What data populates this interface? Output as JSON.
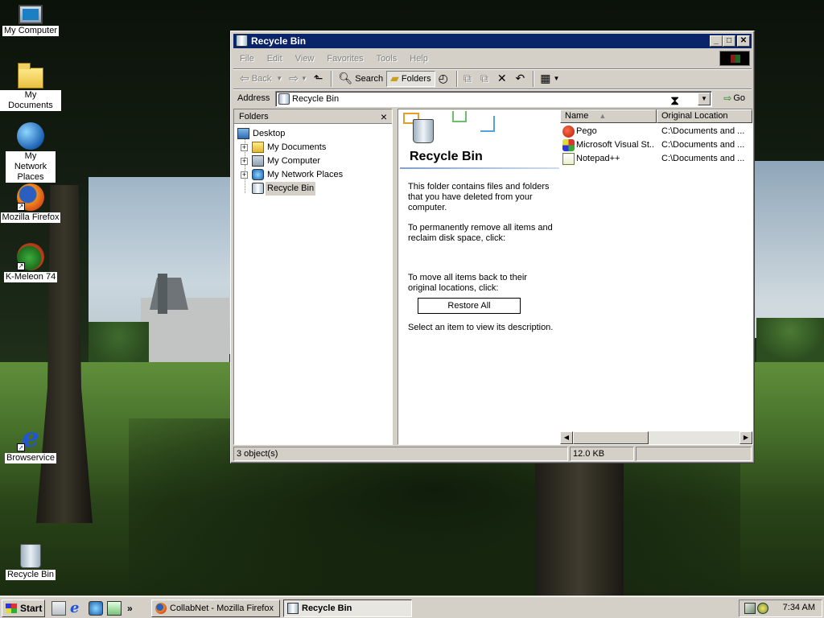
{
  "desktop": {
    "icons": [
      {
        "label": "My Computer",
        "icon": "my-computer-icon"
      },
      {
        "label": "My Documents",
        "icon": "my-documents-icon"
      },
      {
        "label": "My Network Places",
        "icon": "my-network-places-icon"
      },
      {
        "label": "Mozilla Firefox",
        "icon": "firefox-icon"
      },
      {
        "label": "K-Meleon 74",
        "icon": "k-meleon-icon"
      },
      {
        "label": "Browservice",
        "icon": "internet-explorer-icon"
      },
      {
        "label": "Recycle Bin",
        "icon": "recycle-bin-icon"
      }
    ]
  },
  "window": {
    "title": "Recycle Bin",
    "menu": [
      "File",
      "Edit",
      "View",
      "Favorites",
      "Tools",
      "Help"
    ],
    "toolbar": {
      "back": "Back",
      "search": "Search",
      "folders": "Folders"
    },
    "address": {
      "label": "Address",
      "value": "Recycle Bin",
      "go": "Go"
    },
    "folders_pane": {
      "title": "Folders",
      "tree": [
        {
          "label": "Desktop",
          "expandable": false
        },
        {
          "label": "My Documents",
          "expandable": true
        },
        {
          "label": "My Computer",
          "expandable": true
        },
        {
          "label": "My Network Places",
          "expandable": true
        },
        {
          "label": "Recycle Bin",
          "expandable": false,
          "selected": true
        }
      ]
    },
    "info_panel": {
      "title": "Recycle Bin",
      "text1": "This folder contains files and folders that you have deleted from your computer.",
      "text2": "To permanently remove all items and reclaim disk space, click:",
      "text3": "To move all items back to their original locations, click:",
      "restore_button": "Restore All",
      "text4": "Select an item to view its description."
    },
    "list": {
      "columns": [
        "Name",
        "Original Location"
      ],
      "rows": [
        {
          "name": "Pego",
          "location": "C:\\Documents and ..."
        },
        {
          "name": "Microsoft Visual St...",
          "location": "C:\\Documents and ..."
        },
        {
          "name": "Notepad++",
          "location": "C:\\Documents and ..."
        }
      ]
    },
    "status": {
      "objects": "3 object(s)",
      "size": "12.0 KB"
    }
  },
  "taskbar": {
    "start": "Start",
    "tasks": [
      {
        "label": "CollabNet - Mozilla Firefox",
        "active": false
      },
      {
        "label": "Recycle Bin",
        "active": true
      }
    ],
    "clock": "7:34 AM"
  },
  "colors": {
    "titlebar": "#0a246a",
    "face": "#d4d0c8"
  }
}
